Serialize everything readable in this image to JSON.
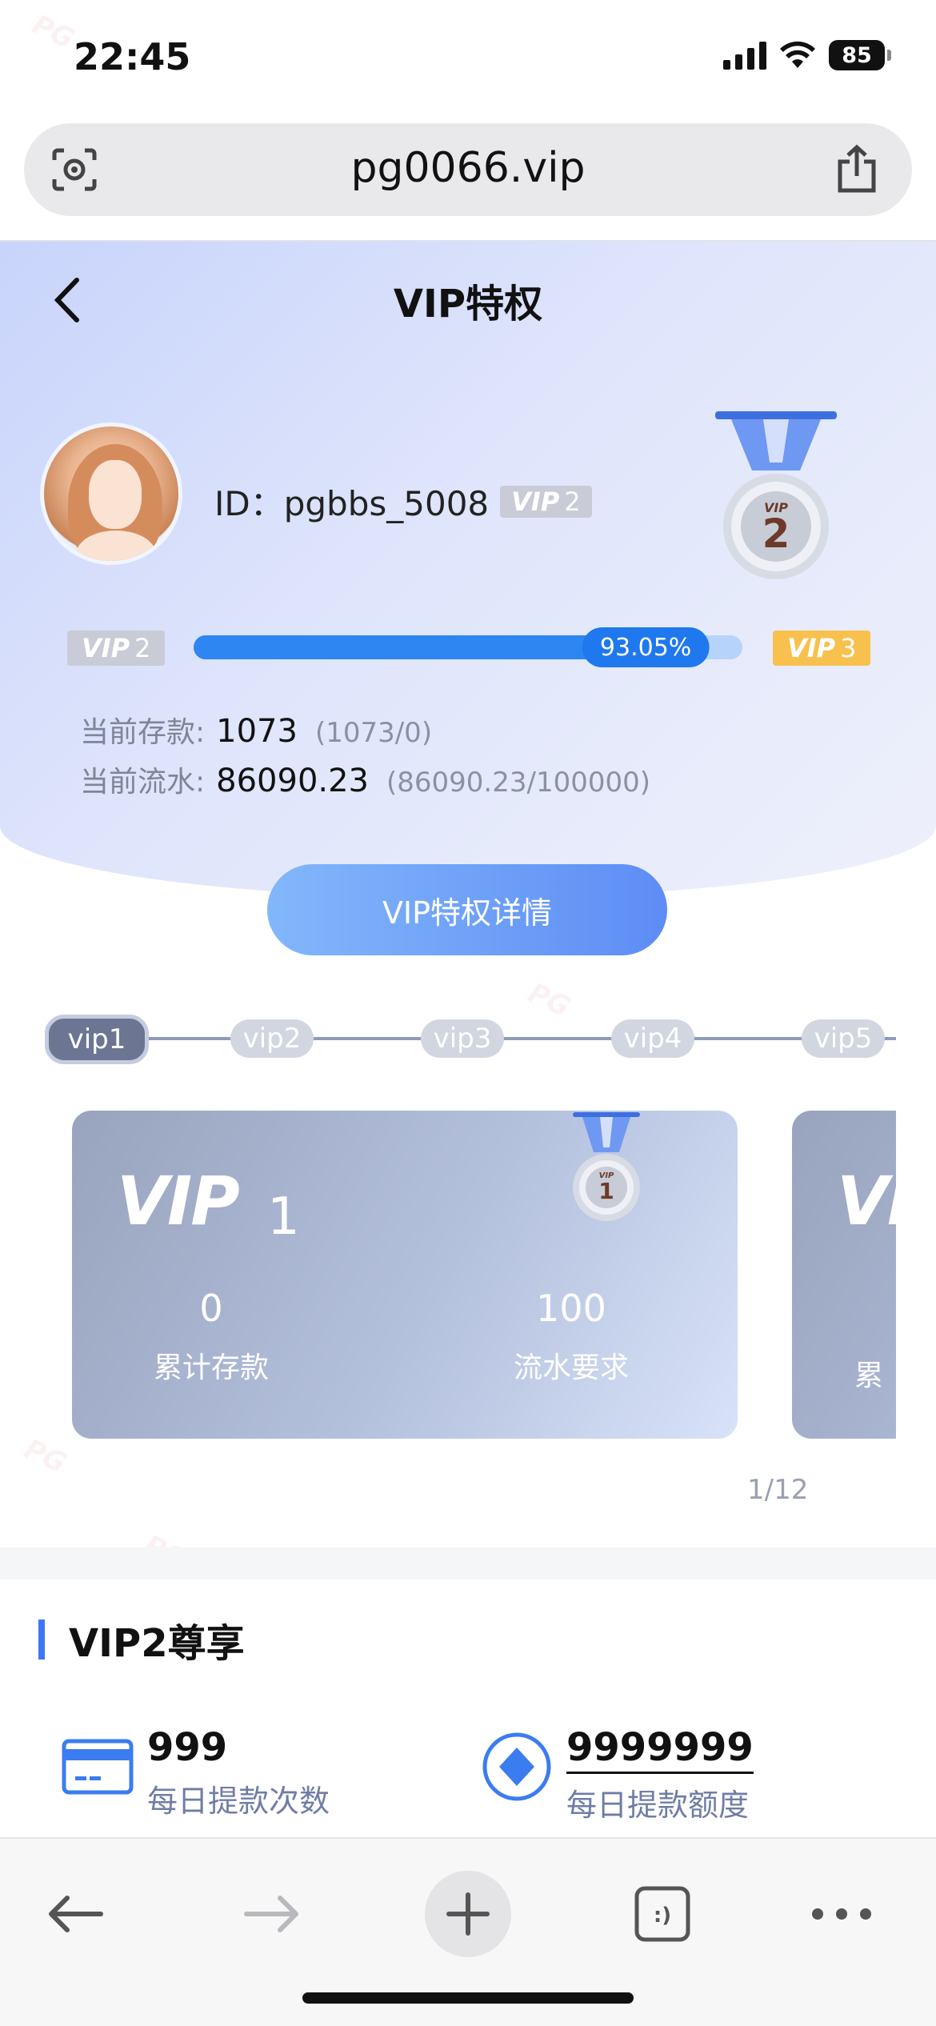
{
  "status_bar": {
    "time": "22:45",
    "battery": "85"
  },
  "browser": {
    "url": "pg0066.vip"
  },
  "header": {
    "title": "VIP特权"
  },
  "user": {
    "id_label": "ID：pgbbs_5008",
    "vip_badge_word": "VIP",
    "vip_badge_level": "2"
  },
  "progress": {
    "current_word": "VIP",
    "current_level": "2",
    "next_word": "VIP",
    "next_level": "3",
    "percent_label": "93.05%",
    "fraction": 0.9305
  },
  "stats": {
    "deposit_label": "当前存款:",
    "deposit_value": "1073",
    "deposit_ratio": "(1073/0)",
    "turnover_label": "当前流水:",
    "turnover_value": "86090.23",
    "turnover_ratio": "(86090.23/100000)"
  },
  "detail_button": "VIP特权详情",
  "level_tabs": [
    "vip1",
    "vip2",
    "vip3",
    "vip4",
    "vip5"
  ],
  "active_level_tab": "vip1",
  "cards": [
    {
      "vip_word": "VIP",
      "level": "1",
      "stat1_value": "0",
      "stat1_label": "累计存款",
      "stat2_value": "100",
      "stat2_label": "流水要求"
    },
    {
      "vip_word": "VIP",
      "stat1_label": "累"
    }
  ],
  "pager": "1/12",
  "benefits_section": {
    "title": "VIP2尊享",
    "items": [
      {
        "value": "999",
        "label": "每日提款次数",
        "icon": "card-icon"
      },
      {
        "value": "9999999",
        "label": "每日提款额度",
        "icon": "diamond-coin-icon"
      }
    ]
  },
  "watermark_text": "PG",
  "colors": {
    "accent": "#3e77f3",
    "progress_fill": "#2d86f2",
    "progress_track": "#b6d4fb",
    "next_level_tag": "#f8c14d",
    "current_level_tag": "#c9ccd6"
  }
}
